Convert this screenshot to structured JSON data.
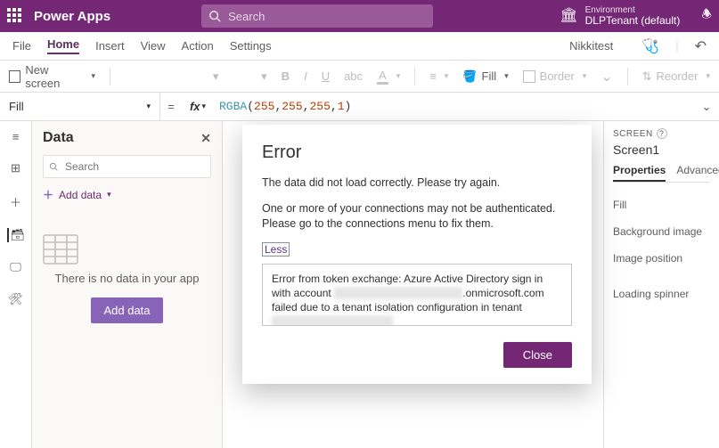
{
  "topbar": {
    "brand": "Power Apps",
    "search_placeholder": "Search",
    "environment_label": "Environment",
    "environment_name": "DLPTenant (default)"
  },
  "menubar": {
    "items": [
      "File",
      "Home",
      "Insert",
      "View",
      "Action",
      "Settings"
    ],
    "active_index": 1,
    "user": "Nikkitest"
  },
  "ribbon": {
    "new_screen": "New screen",
    "fill": "Fill",
    "border": "Border",
    "reorder": "Reorder"
  },
  "formula": {
    "property": "Fill",
    "fn": "RGBA",
    "args": [
      "255",
      "255",
      "255",
      "1"
    ]
  },
  "data_panel": {
    "title": "Data",
    "search_placeholder": "Search",
    "add_data_link": "Add data",
    "empty_message": "There is no data in your app",
    "add_data_button": "Add data"
  },
  "props_panel": {
    "section_label": "SCREEN",
    "screen_name": "Screen1",
    "tabs": [
      "Properties",
      "Advanced"
    ],
    "active_tab": 0,
    "rows": [
      "Fill",
      "Background image",
      "Image position",
      "Loading spinner"
    ]
  },
  "modal": {
    "title": "Error",
    "line1": "The data did not load correctly. Please try again.",
    "line2": "One or more of your connections may not be authenticated. Please go to the connections menu to fix them.",
    "toggle": "Less",
    "details_prefix": "Error from token exchange: Azure Active Directory sign in with account ",
    "details_mid": ".onmicrosoft.com failed due to a tenant isolation configuration in tenant ",
    "close": "Close"
  }
}
